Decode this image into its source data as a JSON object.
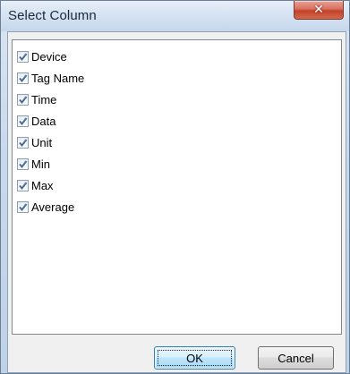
{
  "window": {
    "title": "Select Column",
    "close_icon": "close-icon"
  },
  "list": {
    "items": [
      {
        "label": "Device",
        "checked": true
      },
      {
        "label": "Tag Name",
        "checked": true
      },
      {
        "label": "Time",
        "checked": true
      },
      {
        "label": "Data",
        "checked": true
      },
      {
        "label": "Unit",
        "checked": true
      },
      {
        "label": "Min",
        "checked": true
      },
      {
        "label": "Max",
        "checked": true
      },
      {
        "label": "Average",
        "checked": true
      }
    ]
  },
  "buttons": {
    "ok_label": "OK",
    "cancel_label": "Cancel"
  },
  "colors": {
    "check_mark": "#4d6f95",
    "title_bar": "#d6e3f2",
    "close_button": "#c4402a"
  }
}
